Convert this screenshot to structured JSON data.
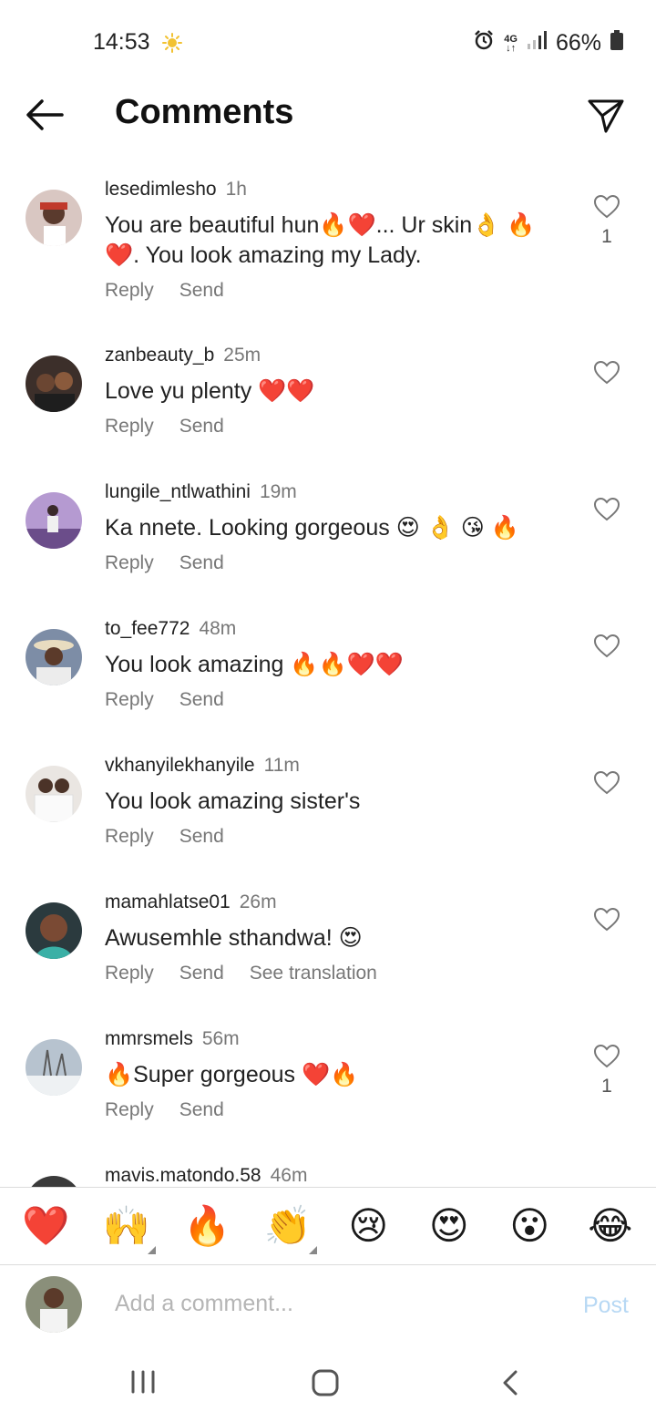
{
  "status_bar": {
    "time": "14:53",
    "network": "4G",
    "battery": "66%"
  },
  "header": {
    "title": "Comments"
  },
  "comments": [
    {
      "user": "lesedimlesho",
      "age": "1h",
      "text": "You are beautiful hun🔥❤️... Ur skin👌 🔥❤️. You look amazing my Lady.",
      "likes": "1",
      "actions": [
        "Reply",
        "Send"
      ]
    },
    {
      "user": "zanbeauty_b",
      "age": "25m",
      "text": "Love yu plenty ❤️❤️",
      "likes": "",
      "actions": [
        "Reply",
        "Send"
      ]
    },
    {
      "user": "lungile_ntlwathini",
      "age": "19m",
      "text": "Ka nnete. Looking gorgeous 😍 👌 😘 🔥",
      "likes": "",
      "actions": [
        "Reply",
        "Send"
      ]
    },
    {
      "user": "to_fee772",
      "age": "48m",
      "text": "You look amazing 🔥🔥❤️❤️",
      "likes": "",
      "actions": [
        "Reply",
        "Send"
      ]
    },
    {
      "user": "vkhanyilekhanyile",
      "age": "11m",
      "text": "You look amazing sister's",
      "likes": "",
      "actions": [
        "Reply",
        "Send"
      ]
    },
    {
      "user": "mamahlatse01",
      "age": "26m",
      "text": "Awusemhle sthandwa! 😍",
      "likes": "",
      "actions": [
        "Reply",
        "Send",
        "See translation"
      ]
    },
    {
      "user": "mmrsmels",
      "age": "56m",
      "text": "🔥Super gorgeous ❤️🔥",
      "likes": "1",
      "actions": [
        "Reply",
        "Send"
      ]
    },
    {
      "user": "mavis.matondo.58",
      "age": "46m",
      "text": "",
      "likes": "",
      "actions": []
    }
  ],
  "emoji_bar": [
    "❤️",
    "🙌",
    "🔥",
    "👏",
    "😢",
    "😍",
    "😮",
    "😂"
  ],
  "compose": {
    "placeholder": "Add a comment...",
    "post_label": "Post"
  },
  "colors": {
    "post_disabled": "#b7d8f4",
    "meta_gray": "#777777"
  }
}
